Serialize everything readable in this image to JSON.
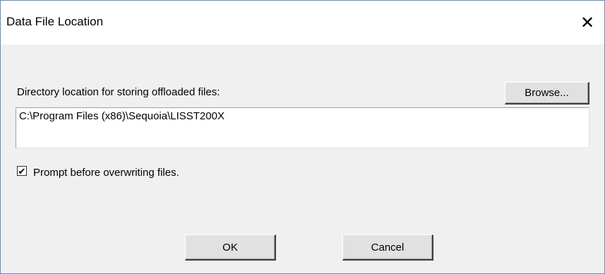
{
  "dialog": {
    "title": "Data File Location",
    "close_glyph": "✕"
  },
  "directory": {
    "label": "Directory location for storing offloaded files:",
    "browse_label": "Browse...",
    "path_value": "C:\\Program Files (x86)\\Sequoia\\LISST200X"
  },
  "prompt_checkbox": {
    "checked": true,
    "check_glyph": "✔",
    "label": "Prompt before overwriting files."
  },
  "buttons": {
    "ok_label": "OK",
    "cancel_label": "Cancel"
  },
  "colors": {
    "window_border": "#5b8fc9",
    "dialog_background": "#f0f0f0",
    "button_face": "#e1e1e1"
  }
}
